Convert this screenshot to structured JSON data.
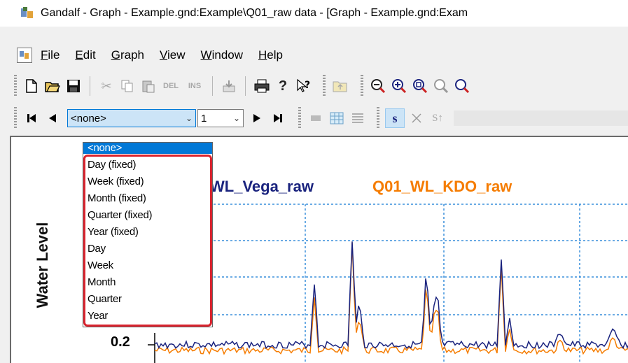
{
  "window": {
    "title": "Gandalf - Graph - Example.gnd:Example\\Q01_raw data - [Graph - Example.gnd:Exam"
  },
  "menu": {
    "items": [
      "File",
      "Edit",
      "Graph",
      "View",
      "Window",
      "Help"
    ]
  },
  "toolbar1": {
    "icons": [
      "new-file-icon",
      "open-folder-icon",
      "save-icon",
      "cut-icon",
      "copy-icon",
      "paste-icon",
      "delete-icon",
      "insert-icon",
      "export-icon",
      "print-icon",
      "help-icon",
      "context-help-icon",
      "folder-up-icon",
      "zoom-out-icon",
      "zoom-in-icon",
      "zoom-fit-icon",
      "zoom-prev-icon",
      "zoom-next-icon"
    ],
    "del_label": "DEL",
    "ins_label": "INS"
  },
  "toolbar2": {
    "period_combo": {
      "value": "<none>"
    },
    "number_combo": {
      "value": "1"
    },
    "s_button": "s",
    "st_button": "S↑"
  },
  "period_dropdown": {
    "selected": "<none>",
    "options": [
      "<none>",
      "Day (fixed)",
      "Week (fixed)",
      "Month (fixed)",
      "Quarter (fixed)",
      "Year (fixed)",
      "Day",
      "Week",
      "Month",
      "Quarter",
      "Year"
    ]
  },
  "graph": {
    "y_axis_label": "Water Level",
    "y_tick": "0.2",
    "legend": [
      {
        "label": "WL_Vega_raw",
        "color": "#1a237e"
      },
      {
        "label": "Q01_WL_KDO_raw",
        "color": "#f57c00"
      }
    ]
  },
  "colors": {
    "selection": "#0078d7",
    "highlight": "#d9232e",
    "grid": "#3a8fdc"
  }
}
